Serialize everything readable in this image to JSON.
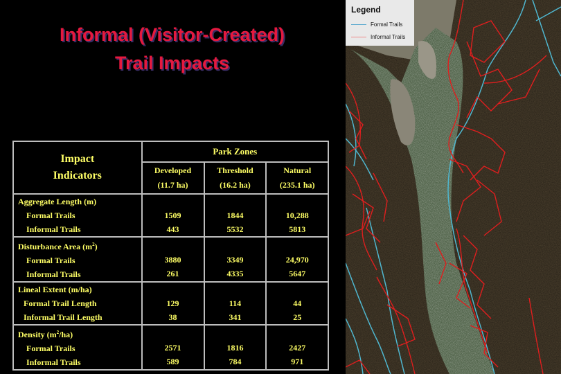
{
  "slide": {
    "title_lines": [
      "Informal (Visitor-Created)",
      "Trail Impacts"
    ]
  },
  "table": {
    "indicators_header": [
      "Impact",
      "Indicators"
    ],
    "park_zones_header": "Park Zones",
    "zones": [
      {
        "name": "Developed",
        "area": "(11.7 ha)"
      },
      {
        "name": "Threshold",
        "area": "(16.2 ha)"
      },
      {
        "name": "Natural",
        "area": "(235.1 ha)"
      }
    ],
    "sections": [
      {
        "title": "Aggregate Length  (m)",
        "rows": [
          {
            "label": "Formal Trails",
            "values": [
              "1509",
              "1844",
              "10,288"
            ]
          },
          {
            "label": "Informal Trails",
            "values": [
              "443",
              "5532",
              "5813"
            ]
          }
        ]
      },
      {
        "title": "Disturbance Area  (m",
        "title_sup": "2",
        "title_suffix": ")",
        "rows": [
          {
            "label": "Formal Trails",
            "values": [
              "3880",
              "3349",
              "24,970"
            ]
          },
          {
            "label": "Informal Trails",
            "values": [
              "261",
              "4335",
              "5647"
            ]
          }
        ]
      },
      {
        "title": "Lineal Extent  (m/ha)",
        "rows": [
          {
            "label": "Formal Trail Length",
            "values": [
              "129",
              "114",
              "44"
            ]
          },
          {
            "label": "Informal Trail Length",
            "values": [
              "38",
              "341",
              "25"
            ]
          }
        ]
      },
      {
        "title": "Density  (m",
        "title_sup": "2",
        "title_suffix": "/ha)",
        "rows": [
          {
            "label": "Formal Trails",
            "values": [
              "2571",
              "1816",
              "2427"
            ]
          },
          {
            "label": "Informal Trails",
            "values": [
              "589",
              "784",
              "971"
            ]
          }
        ]
      }
    ]
  },
  "legend": {
    "title": "Legend",
    "items": [
      {
        "label": "Formal Trails",
        "color": "#5aa9cf"
      },
      {
        "label": "Informal Trails",
        "color": "#f08a8a"
      }
    ]
  },
  "map": {
    "formal_trail_color": "#4fb7d0",
    "informal_trail_color": "#e01e1e"
  }
}
